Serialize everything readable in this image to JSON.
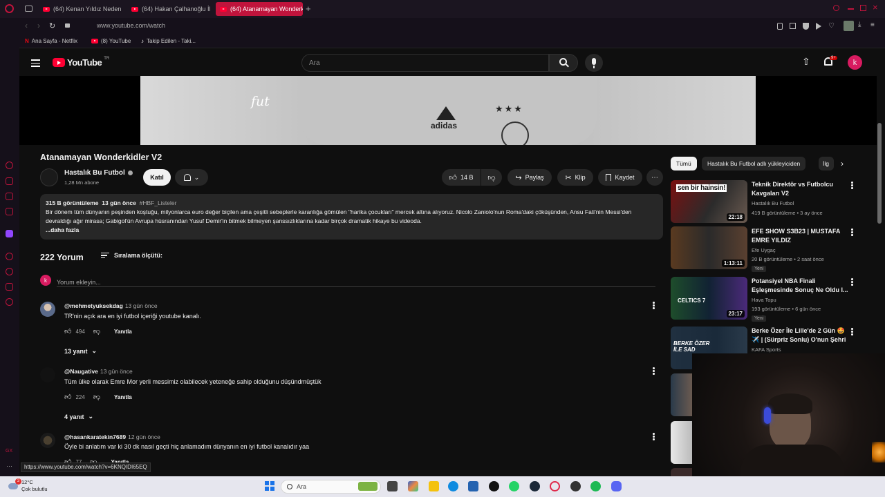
{
  "browser": {
    "tabs": [
      {
        "label": "(64) Kenan Yıldız Neden B"
      },
      {
        "label": "(64) Hakan Çalhanoğlu İle"
      },
      {
        "label": "(64) Atanamayan Wonderk"
      }
    ],
    "url": "www.youtube.com/watch",
    "bookmarks": [
      {
        "label": "Ana Sayfa - Netflix"
      },
      {
        "label": "(8) YouTube"
      },
      {
        "label": "Takip Edilen - Taki..."
      }
    ],
    "status_url": "https://www.youtube.com/watch?v=6KNQIDI65EQ"
  },
  "header": {
    "logo_text": "YouTube",
    "logo_sup": "TR",
    "search_placeholder": "Ara",
    "notif_count": "9+",
    "avatar_letter": "k"
  },
  "player": {
    "overlay_text": "fut",
    "brand_text": "adidas"
  },
  "video": {
    "title": "Atanamayan Wonderkidler V2",
    "channel": "Hastalık Bu Futbol",
    "subscribers": "1,28 Mn abone",
    "join_label": "Katıl",
    "likes": "14 B",
    "share_label": "Paylaş",
    "clip_label": "Klip",
    "save_label": "Kaydet",
    "views": "315 B görüntüleme",
    "age": "13 gün önce",
    "hashtag": "#HBF_Listeler",
    "description": "Bir dönem tüm dünyanın peşinden koştuğu, milyonlarca euro değer biçilen ama çeşitli sebeplerle karanlığa gömülen \"harika çocukları\" mercek altına alıyoruz. Nicolo Zaniolo'nun Roma'daki çöküşünden, Ansu Fati'nin Messi'den devraldığı ağır mirasa; Gabigol'ün Avrupa hüsranından Yusuf Demir'in bitmek bilmeyen şanssızlıklarına kadar birçok dramatik hikaye bu videoda.",
    "more_label": "...daha fazla"
  },
  "comments": {
    "count_label": "222 Yorum",
    "sort_label": "Sıralama ölçütü:",
    "add_placeholder": "Yorum ekleyin...",
    "my_avatar": "k",
    "reply_label": "Yanıtla",
    "items": [
      {
        "user": "@mehmetyuksekdag",
        "time": "13 gün önce",
        "text": "TR'nin açık ara en iyi futbol içeriği youtube kanalı.",
        "likes": "494",
        "replies": "13 yanıt"
      },
      {
        "user": "@Naugative",
        "time": "13 gün önce",
        "text": "Tüm ülke olarak Emre Mor yerli messimiz olabilecek yeteneğe sahip olduğunu düşündmüştük",
        "likes": "224",
        "replies": "4 yanıt"
      },
      {
        "user": "@hasankaratekin7689",
        "time": "12 gün önce",
        "text": "Öyle bi anlatım var ki 30 dk nasıl geçti hiç anlamadım dünyanın en iyi futbol kanalıdır yaa",
        "likes": "77",
        "replies": ""
      }
    ]
  },
  "chips": [
    {
      "label": "Tümü"
    },
    {
      "label": "Hastalık Bu Futbol adlı yükleyiciden"
    },
    {
      "label": "İlg"
    }
  ],
  "related": [
    {
      "title": "Teknik Direktör vs Futbolcu Kavgaları V2",
      "channel": "Hastalık Bu Futbol",
      "meta": "419 B görüntüleme • 3 ay önce",
      "duration": "22:18",
      "badge": "",
      "thumb_text": "sen bir hainsin!"
    },
    {
      "title": "EFE SHOW S3B23 | MUSTAFA EMRE YILDIZ",
      "channel": "Efe Uygaç",
      "meta": "20 B görüntüleme • 2 saat önce",
      "duration": "1:13:11",
      "badge": "Yeni",
      "thumb_text": ""
    },
    {
      "title": "Potansiyel NBA Finali Eşleşmesinde Sonuç Ne Oldu I...",
      "channel": "Hava Topu",
      "meta": "193 görüntüleme • 6 gün önce",
      "duration": "23:17",
      "badge": "Yeni",
      "thumb_text": "CELTICS 7"
    },
    {
      "title": "Berke Özer İle Lille'de 2 Gün 🤩 ✈️ | (Sürpriz Sonlu) O'nun Şehri",
      "channel": "KAFA Sports",
      "meta": "",
      "duration": "",
      "badge": "",
      "thumb_text": "BERKE ÖZER İLE SAD"
    }
  ],
  "taskbar": {
    "temp": "12°C",
    "weather": "Çok bulutlu",
    "search_label": "Ara",
    "weather_badge": "3"
  },
  "colors": {
    "accent": "#c0143c",
    "yt_red": "#ff0033",
    "bg": "#0f0f0f"
  }
}
